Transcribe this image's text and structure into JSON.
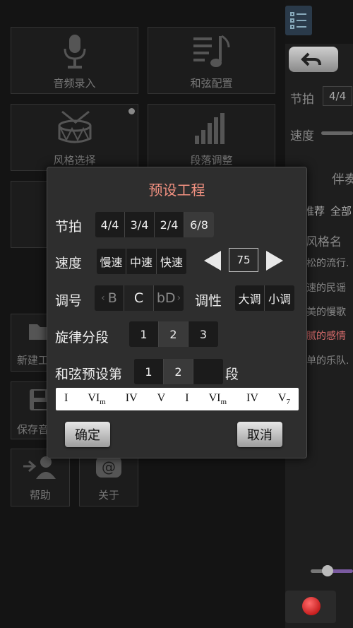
{
  "menu": {
    "tiles": [
      {
        "label": "音频录入",
        "icon": "microphone-icon"
      },
      {
        "label": "和弦配置",
        "icon": "music-note-icon"
      },
      {
        "label": "风格选择",
        "icon": "drum-icon"
      },
      {
        "label": "段落调整",
        "icon": "equalizer-icon"
      }
    ],
    "side_items": [
      {
        "label": "新建工",
        "icon": "folder-icon"
      },
      {
        "label": "保存音",
        "icon": "save-icon"
      },
      {
        "label": "帮助",
        "icon": "help-user-icon"
      },
      {
        "label": "关于",
        "icon": "at-icon"
      }
    ]
  },
  "right_panel": {
    "beat_label": "节拍",
    "beat_value": "4/4",
    "speed_label": "速度",
    "accompany_label": "伴奏",
    "filter_tabs": [
      "推荐",
      "全部"
    ],
    "style_header": "风格名",
    "styles": [
      "松的流行.",
      "速的民谣",
      "美的慢歌",
      "腻的感情",
      "单的乐队."
    ],
    "highlight_color": "#d86c6c"
  },
  "dialog": {
    "title": "预设工程",
    "beat": {
      "label": "节拍",
      "options": [
        "4/4",
        "3/4",
        "2/4",
        "6/8"
      ],
      "selected": "6/8"
    },
    "speed": {
      "label": "速度",
      "options": [
        "慢速",
        "中速",
        "快速"
      ],
      "value": "75"
    },
    "key": {
      "label": "调号",
      "options": [
        "B",
        "C",
        "bD"
      ],
      "selected": "C"
    },
    "mode": {
      "label": "调性",
      "options": [
        "大调",
        "小调"
      ]
    },
    "melody": {
      "label": "旋律分段",
      "options": [
        "1",
        "2",
        "3"
      ],
      "selected": "2"
    },
    "chord_preset": {
      "label_prefix": "和弦预设第",
      "label_suffix": "段",
      "options": [
        "1",
        "2",
        ""
      ],
      "selected": "2"
    },
    "chords": [
      {
        "root": "I",
        "sub": ""
      },
      {
        "root": "VI",
        "sub": "m"
      },
      {
        "root": "IV",
        "sub": ""
      },
      {
        "root": "V",
        "sub": ""
      },
      {
        "root": "I",
        "sub": ""
      },
      {
        "root": "VI",
        "sub": "m"
      },
      {
        "root": "IV",
        "sub": ""
      },
      {
        "root": "V",
        "sub": "7"
      }
    ],
    "confirm_label": "确定",
    "cancel_label": "取消",
    "title_color": "#f09080"
  }
}
